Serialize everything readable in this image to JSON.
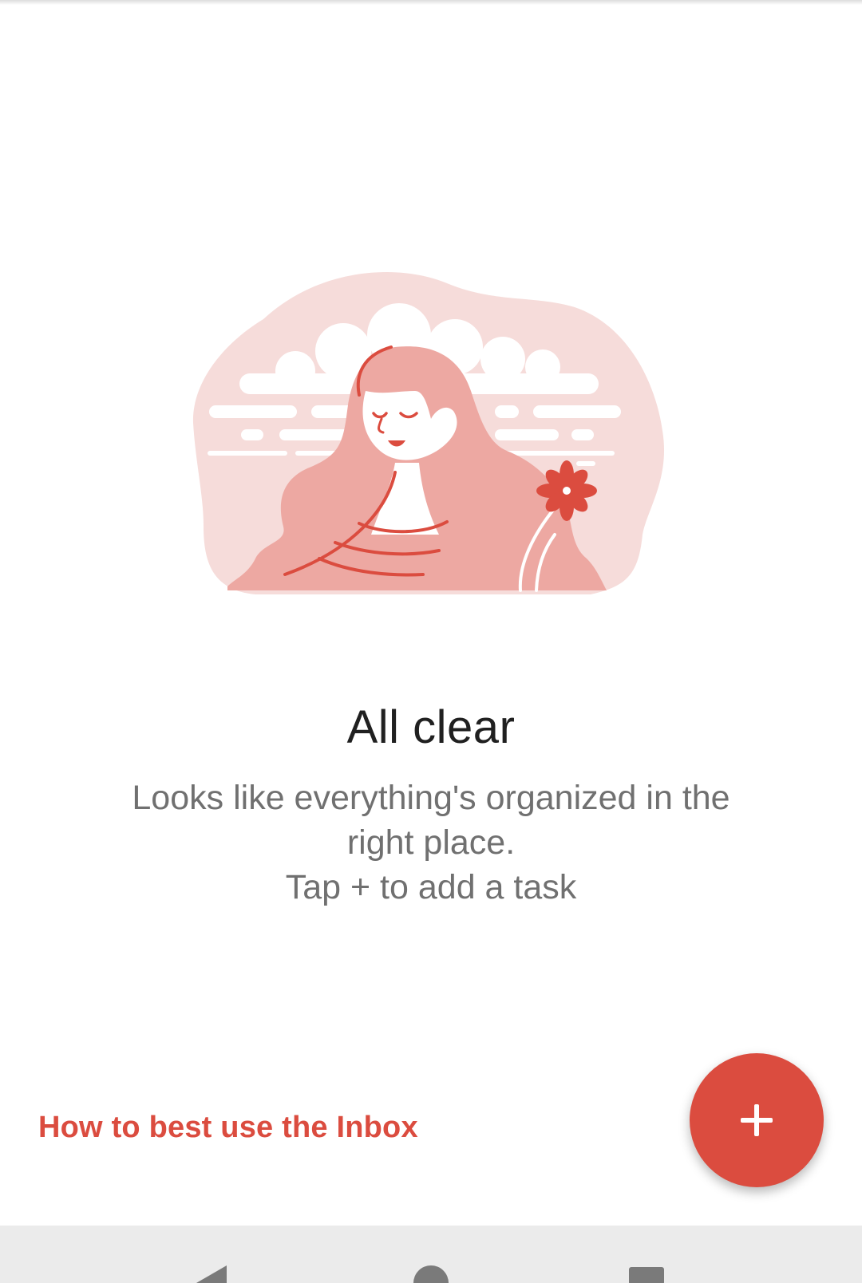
{
  "empty_state": {
    "title": "All clear",
    "line1": "Looks like everything's organized in the",
    "line2": "right place.",
    "line3": "Tap + to add a task"
  },
  "help_link": "How to best use the Inbox",
  "fab": {
    "icon": "plus-icon"
  },
  "navbar": {
    "icons": [
      "back-icon",
      "home-icon",
      "recents-icon"
    ]
  },
  "colors": {
    "accent": "#db4c3f",
    "illustration_light": "#f6dcda",
    "illustration_mid": "#eda8a2"
  }
}
